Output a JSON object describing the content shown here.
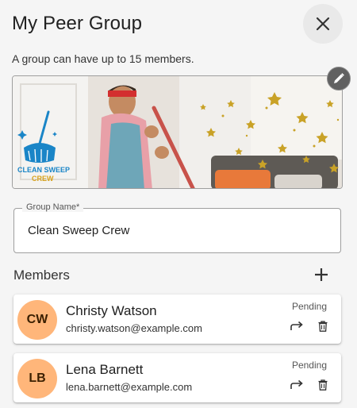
{
  "dialog": {
    "title": "My Peer Group",
    "subtitle": "A group can have up to 15 members.",
    "close_icon": "close-icon",
    "edit_icon": "pencil-icon"
  },
  "banner": {
    "logo_text_line1": "CLEAN SWEEP",
    "logo_text_line2": "CREW",
    "logo_icon": "broom-icon",
    "colors": {
      "logo_blue": "#1a85c7",
      "logo_gold": "#d7a21c",
      "star_gold": "#c9a227"
    }
  },
  "group_name": {
    "label": "Group Name*",
    "value": "Clean Sweep Crew"
  },
  "members": {
    "heading": "Members",
    "add_icon": "plus-icon",
    "items": [
      {
        "initials": "CW",
        "name": "Christy Watson",
        "email": "christy.watson@example.com",
        "status": "Pending"
      },
      {
        "initials": "LB",
        "name": "Lena Barnett",
        "email": "lena.barnett@example.com",
        "status": "Pending"
      }
    ],
    "resend_icon": "resend-icon",
    "delete_icon": "trash-icon"
  },
  "colors": {
    "avatar": "#ffb67a",
    "background": "#f5f5f5"
  }
}
